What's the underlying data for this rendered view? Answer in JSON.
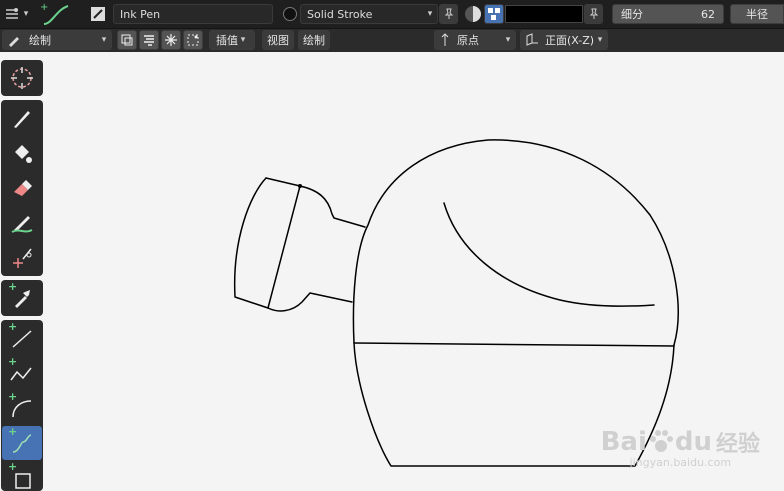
{
  "header1": {
    "brush_name": "Ink Pen",
    "material_name": "Solid Stroke",
    "subdivide_label": "细分",
    "subdivide_value": "62",
    "radius_label": "半径",
    "color_swatch": "#000000"
  },
  "header2": {
    "mode": "绘制",
    "interpolate": "插值",
    "view_menu": "视图",
    "draw_menu": "绘制",
    "origin": "原点",
    "plane": "正面(X-Z)"
  },
  "toolbar": {
    "tools": [
      "cursor-icon",
      "draw-icon",
      "fill-icon",
      "erase-icon",
      "tint-icon",
      "cutter-icon",
      "eyedropper-icon",
      "line-icon",
      "polyline-icon",
      "arc-icon",
      "curve-icon",
      "box-icon"
    ],
    "active_tool": "curve-icon"
  },
  "colors": {
    "accent": "#4772b3",
    "header_bg": "#1f1f1f",
    "viewport_bg": "#f4f4f4",
    "stroke": "#000000",
    "add_green": "#6ad48d"
  },
  "watermark": {
    "brand": "Bai",
    "brand2": "du",
    "cn": "经验",
    "url": "jingyan.baidu.com"
  }
}
